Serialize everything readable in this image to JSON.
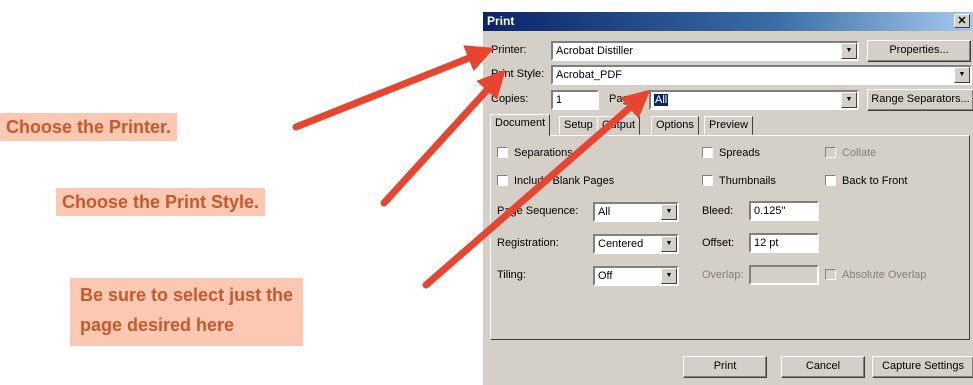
{
  "dialog": {
    "title": "Print",
    "printer_label": "Printer:",
    "printer_value": "Acrobat Distiller",
    "properties_button": "Properties...",
    "print_style_label": "Print Style:",
    "print_style_value": "Acrobat_PDF",
    "copies_label": "Copies:",
    "copies_value": "1",
    "pages_label": "Pages:",
    "pages_value": "All",
    "range_separators_button": "Range Separators...",
    "tabs": [
      "Document",
      "Setup",
      "Output",
      "Options",
      "Preview"
    ],
    "active_tab": "Document",
    "checkboxes": {
      "separations": "Separations",
      "spreads": "Spreads",
      "collate": "Collate",
      "include_blank_pages": "Include Blank Pages",
      "thumbnails": "Thumbnails",
      "back_to_front": "Back to Front",
      "absolute_overlap": "Absolute Overlap"
    },
    "page_sequence_label": "Page Sequence:",
    "page_sequence_value": "All",
    "bleed_label": "Bleed:",
    "bleed_value": "0.125\"",
    "registration_label": "Registration:",
    "registration_value": "Centered",
    "offset_label": "Offset:",
    "offset_value": "12 pt",
    "tiling_label": "Tiling:",
    "tiling_value": "Off",
    "overlap_label": "Overlap:",
    "overlap_value": "",
    "print_button": "Print",
    "cancel_button": "Cancel",
    "capture_settings_button": "Capture Settings"
  },
  "callouts": {
    "printer": "Choose the Printer.",
    "print_style": "Choose the Print Style.",
    "pages_line1": "Be sure to select just the",
    "pages_line2": "page desired here"
  },
  "colors": {
    "arrow": "#e8442e",
    "callout_bg": "#fbc8b4",
    "callout_text": "#c8592a",
    "dialog_bg": "#d4d0c8",
    "titlebar": "#0a246a"
  }
}
